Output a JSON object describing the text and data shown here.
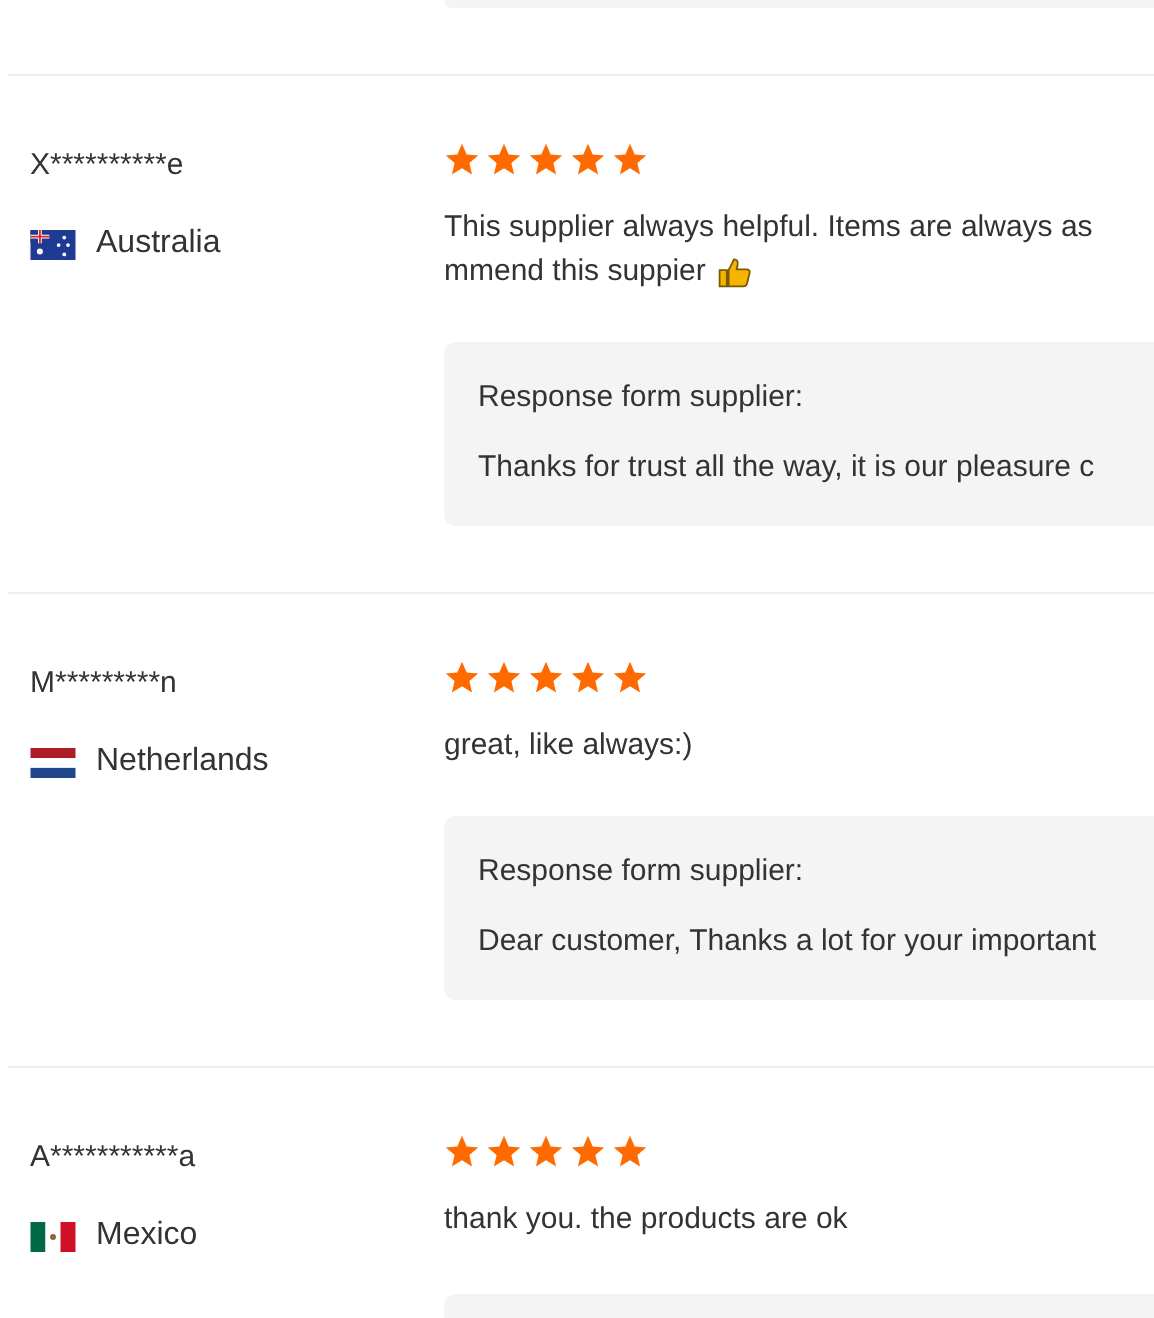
{
  "reviews": [
    {
      "name": "X**********e",
      "country": "Australia",
      "flag": {
        "kind": "australia"
      },
      "stars": 5,
      "comment_lines": [
        [
          {
            "kind": "text",
            "text": "This supplier always helpful. Items are always as"
          }
        ],
        [
          {
            "kind": "text",
            "text": "mmend this suppier"
          },
          {
            "kind": "thumbs_up"
          }
        ]
      ],
      "response": {
        "label": "Response form supplier:",
        "text": "Thanks for trust all the way, it is our pleasure c"
      }
    },
    {
      "name": "M*********n",
      "country": "Netherlands",
      "flag": {
        "kind": "netherlands"
      },
      "stars": 5,
      "comment_lines": [
        [
          {
            "kind": "text",
            "text": "great, like always:)"
          }
        ]
      ],
      "response": {
        "label": "Response form supplier:",
        "text": "Dear customer, Thanks a lot for your important"
      }
    },
    {
      "name": "A***********a",
      "country": "Mexico",
      "flag": {
        "kind": "mexico"
      },
      "stars": 5,
      "comment_lines": [
        [
          {
            "kind": "text",
            "text": "thank you. the products are ok"
          }
        ]
      ],
      "response": {
        "cut_off": true
      }
    }
  ]
}
